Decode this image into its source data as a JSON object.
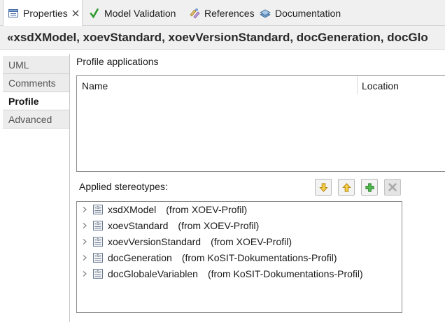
{
  "tabs": [
    {
      "label": "Properties",
      "icon": "properties-icon",
      "active": true
    },
    {
      "label": "Model Validation",
      "icon": "checkmark-icon"
    },
    {
      "label": "References",
      "icon": "references-icon"
    },
    {
      "label": "Documentation",
      "icon": "documentation-icon"
    }
  ],
  "title": "«xsdXModel, xoevStandard, xoevVersionStandard, docGeneration, docGlo",
  "side_tabs": [
    {
      "label": "UML"
    },
    {
      "label": "Comments"
    },
    {
      "label": "Profile",
      "selected": true
    },
    {
      "label": "Advanced"
    }
  ],
  "profile_applications": {
    "label": "Profile applications",
    "columns": [
      "Name",
      "Location"
    ]
  },
  "applied_stereotypes": {
    "label": "Applied stereotypes:",
    "items": [
      {
        "name": "xsdXModel",
        "from": "(from XOEV-Profil)"
      },
      {
        "name": "xoevStandard",
        "from": "(from XOEV-Profil)"
      },
      {
        "name": "xoevVersionStandard",
        "from": "(from XOEV-Profil)"
      },
      {
        "name": "docGeneration",
        "from": "(from KoSIT-Dokumentations-Profil)"
      },
      {
        "name": "docGlobaleVariablen",
        "from": "(from KoSIT-Dokumentations-Profil)"
      }
    ]
  },
  "colors": {
    "accent_green": "#2e9a2e",
    "arrow_yellow": "#e6b422",
    "disabled": "#9a9a9a"
  }
}
